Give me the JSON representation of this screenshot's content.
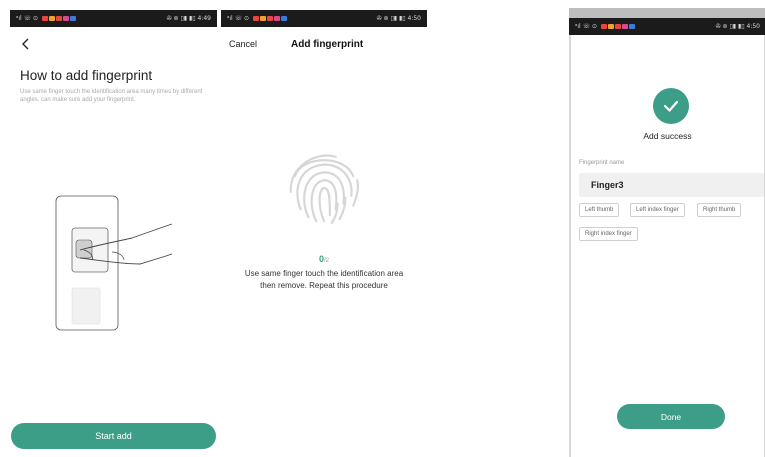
{
  "colors": {
    "accent": "#3c9e86",
    "statusbar": "#1b1b1b",
    "field_bg": "#f0f0f0"
  },
  "screen1": {
    "statusbar": {
      "left": "ᵃıl ☏ ⊙",
      "right": "✇ ⊚ ▯▮ ▮▯ 4:49"
    },
    "back_icon": "chevron-left-icon",
    "title": "How to add fingerprint",
    "description": "Use same finger touch the identification area many times by different angles, can make sure add your fingerprint.",
    "start_button": "Start add"
  },
  "screen2": {
    "statusbar": {
      "left": "ᵃıl ☏ ⊙",
      "right": "✇ ⊚ ▯▮ ▮▯ 4:50"
    },
    "cancel": "Cancel",
    "title": "Add fingerprint",
    "progress": {
      "current": "0",
      "total": "/2"
    },
    "instruction": "Use same finger touch the identification area then remove. Repeat this procedure"
  },
  "screen3": {
    "statusbar": {
      "left": "ᵃıl ☏ ⊙",
      "right": "✇ ⊚ ▯▮ ▮▯ 4:50"
    },
    "success_text": "Add success",
    "field_label": "Fingerprint name",
    "field_value": "Finger3",
    "tags": [
      "Left thumb",
      "Left index finger",
      "Right thumb",
      "Right index finger"
    ],
    "done_button": "Done"
  }
}
